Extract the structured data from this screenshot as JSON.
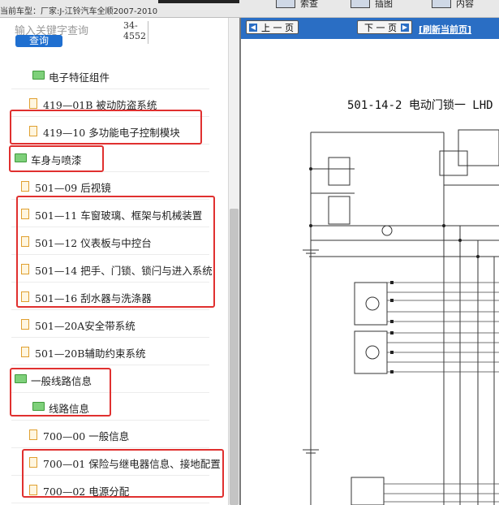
{
  "header": {
    "vehicle_label": "当前车型：厂家:J-江铃汽车全顺2007-2010",
    "buttons": [
      {
        "label": "索查",
        "icon": "window-icon"
      },
      {
        "label": "插图",
        "icon": "window-icon"
      },
      {
        "label": "内容",
        "icon": "window-icon"
      }
    ]
  },
  "search": {
    "placeholder": "输入关键字查询",
    "button_label": "查询",
    "result_count": "34-4552"
  },
  "tree": {
    "items": [
      {
        "label": "电子特征组件",
        "type": "folder"
      },
      {
        "label": "419—01B 被动防盗系统",
        "type": "doc"
      },
      {
        "label": "419—10 多功能电子控制模块",
        "type": "doc"
      },
      {
        "label": "车身与喷漆",
        "type": "folder"
      },
      {
        "label": "501—09 后视镜",
        "type": "doc"
      },
      {
        "label": "501—11 车窗玻璃、框架与机械装置",
        "type": "doc"
      },
      {
        "label": "501—12 仪表板与中控台",
        "type": "doc"
      },
      {
        "label": "501—14 把手、门锁、锁闩与进入系统",
        "type": "doc"
      },
      {
        "label": "501—16 刮水器与洗涤器",
        "type": "doc"
      },
      {
        "label": "501—20A安全带系统",
        "type": "doc"
      },
      {
        "label": "501—20B辅助约束系统",
        "type": "doc"
      },
      {
        "label": "一般线路信息",
        "type": "folder"
      },
      {
        "label": "线路信息",
        "type": "folder"
      },
      {
        "label": "700—00 一般信息",
        "type": "doc"
      },
      {
        "label": "700—01 保险与继电器信息、接地配置",
        "type": "doc"
      },
      {
        "label": "700—02 电源分配",
        "type": "doc"
      }
    ]
  },
  "viewer": {
    "prev_label": "上 一 页",
    "next_label": "下 一 页",
    "refresh_label": "[刷新当前页]",
    "diagram_title": "501-14-2  电动门锁一 LHD"
  },
  "colors": {
    "accent": "#2a6ec4",
    "highlight": "#e0302f",
    "folder": "#7ed07a",
    "doc": "#e0a030"
  }
}
